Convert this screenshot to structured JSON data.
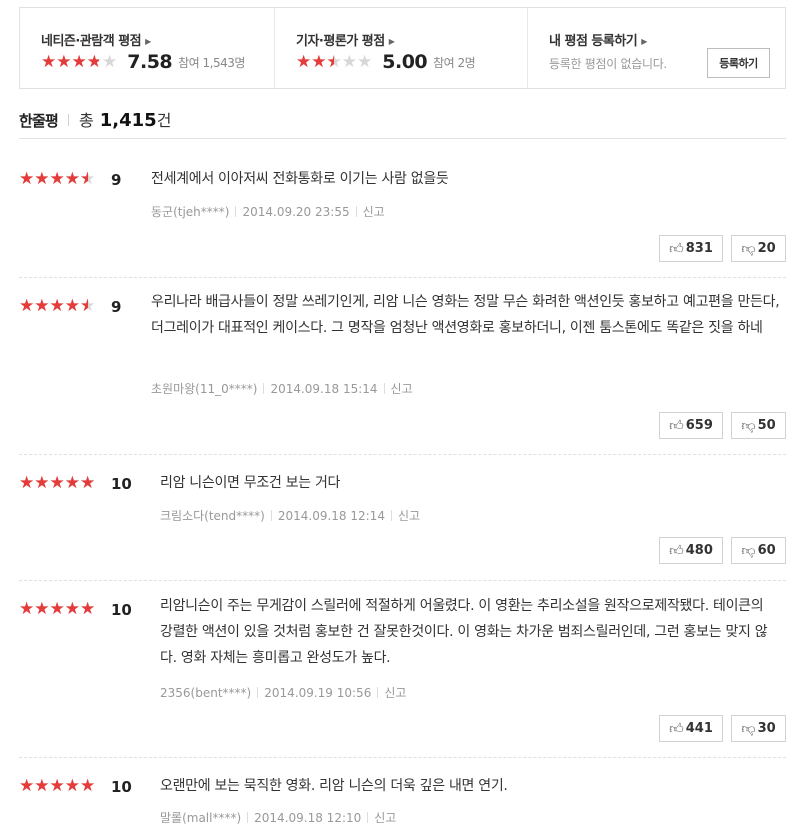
{
  "summary": {
    "netizen": {
      "title": "네티즌·관람객 평점",
      "score": "7.58",
      "participants": "참여 1,543명",
      "star_fraction": 0.758
    },
    "critic": {
      "title": "기자·평론가 평점",
      "score": "5.00",
      "participants": "참여 2명",
      "star_fraction": 0.5
    },
    "mine": {
      "title": "내 평점 등록하기",
      "empty_text": "등록한 평점이 없습니다.",
      "button_label": "등록하기"
    }
  },
  "list_header": {
    "title": "한줄평",
    "total_label": "총",
    "count": "1,415",
    "unit": "건"
  },
  "colors": {
    "star_filled": "#e53b3b",
    "star_empty": "#d7d7d7"
  },
  "reviews": [
    {
      "rating": 9,
      "score": "9",
      "text": "전세계에서 이아저씨 전화통화로 이기는 사람 없을듯",
      "user": "동군(tjeh****)",
      "date": "2014.09.20 23:55",
      "report": "신고",
      "likes": "831",
      "dislikes": "20"
    },
    {
      "rating": 9,
      "score": "9",
      "text": "우리나라 배급사들이 정말 쓰레기인게, 리암 니슨 영화는 정말 무슨 화려한 액션인듯 홍보하고 예고편을 만든다, 더그레이가 대표적인 케이스다. 그 명작을 엄청난 액션영화로 홍보하더니, 이젠 툼스톤에도 똑같은 짓을 하네",
      "user": "초원마왕(11_0****)",
      "date": "2014.09.18 15:14",
      "report": "신고",
      "likes": "659",
      "dislikes": "50"
    },
    {
      "rating": 10,
      "score": "10",
      "text": "리암 니슨이면 무조건 보는 거다",
      "user": "크림소다(tend****)",
      "date": "2014.09.18 12:14",
      "report": "신고",
      "likes": "480",
      "dislikes": "60"
    },
    {
      "rating": 10,
      "score": "10",
      "text": "리암니슨이 주는 무게감이 스릴러에 적절하게 어울렸다. 이 영환는 추리소설을 원작으로제작됐다. 테이큰의 강렬한 액션이 있을 것처럼 홍보한 건 잘못한것이다. 이 영화는 차가운 범죄스릴러인데, 그런 홍보는 맞지 않다. 영화 자체는 흥미롭고 완성도가 높다.",
      "user": "2356(bent****)",
      "date": "2014.09.19 10:56",
      "report": "신고",
      "likes": "441",
      "dislikes": "30"
    },
    {
      "rating": 10,
      "score": "10",
      "text": "오랜만에 보는 묵직한 영화. 리암 니슨의 더욱 깊은 내면 연기.",
      "user": "말롤(mall****)",
      "date": "2014.09.18 12:10",
      "report": "신고",
      "likes": "",
      "dislikes": ""
    }
  ]
}
